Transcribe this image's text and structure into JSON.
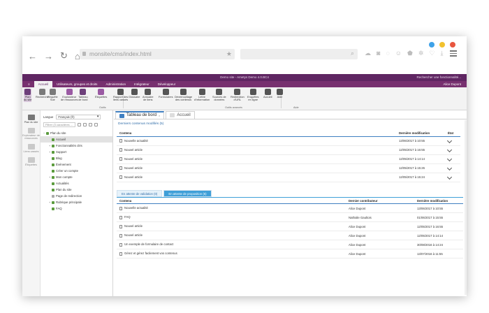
{
  "browser": {
    "url": "monsite/cms/index.html",
    "dot_colors": [
      "#3fa2e8",
      "#f2c12e",
      "#e8563f"
    ]
  },
  "app": {
    "titlebar": "Demo site - Ametys Demo 4.0.BC4",
    "search_hint": "Rechercher une fonctionnalité...",
    "user": "Alice Dupont",
    "ribbon_tabs": [
      "Accueil",
      "Utilisateurs, groupes et droits",
      "Administration",
      "Intégrateur",
      "Développeur"
    ],
    "ribbon_buttons": [
      {
        "label": "Plan\ndu site",
        "color": "#6d3f7a"
      },
      {
        "label": "Recherche",
        "color": "#7a7a7a"
      },
      {
        "label": "Requête\nSolr",
        "color": "#7a7a7a"
      },
      {
        "label": "Explorateur\nde ressources",
        "color": "#9a5aa3"
      },
      {
        "label": "Tableau\nde bord",
        "color": "#6d3f7a"
      },
      {
        "label": "Étiquettes",
        "color": "#9a5aa3"
      },
      {
        "label": "Rapport des\nliens cassés",
        "color": "#555555"
      },
      {
        "label": "Glossaire",
        "color": "#555555"
      },
      {
        "label": "Annuaire\nde liens",
        "color": "#555555"
      },
      {
        "label": "Formulaires",
        "color": "#555555"
      },
      {
        "label": "Déverrouillage\ndes contenus",
        "color": "#555555"
      },
      {
        "label": "Lettre\nd'information",
        "color": "#555555"
      },
      {
        "label": "Sources de\ndonnées",
        "color": "#555555"
      },
      {
        "label": "Redirection\nd'URL",
        "color": "#555555"
      },
      {
        "label": "Enquêtes\nen ligne",
        "color": "#555555"
      },
      {
        "label": "Accueil",
        "color": "#555555"
      },
      {
        "label": "Aide",
        "color": "#555555"
      }
    ],
    "groups": [
      "Outils",
      "Outils avancés",
      "Aide"
    ]
  },
  "rail": {
    "items": [
      "Plan\ndu site",
      "Explorateur\nde ressources",
      "Liens\ncassés",
      "Étiquettes"
    ]
  },
  "tree": {
    "language_label": "Langue",
    "language_value": "Français (fr)",
    "filter_placeholder": "Filtrer (3 caractères ...",
    "nodes": [
      {
        "label": "Plan du site",
        "level": 0,
        "color": "#5b9b3d"
      },
      {
        "label": "Accueil",
        "level": 1,
        "color": "#5b9b3d",
        "selected": true
      },
      {
        "label": "Fonctionnalités clés",
        "level": 1,
        "color": "#5b9b3d",
        "expand": true
      },
      {
        "label": "Support",
        "level": 1,
        "color": "#5b9b3d",
        "expand": true
      },
      {
        "label": "Blog",
        "level": 1,
        "color": "#5b9b3d"
      },
      {
        "label": "Événement",
        "level": 1,
        "color": "#5b9b3d"
      },
      {
        "label": "Créer un compte",
        "level": 1,
        "color": "#5b9b3d"
      },
      {
        "label": "Mon compte",
        "level": 1,
        "color": "#5b9b3d",
        "expand": true
      },
      {
        "label": "Actualités",
        "level": 1,
        "color": "#5b9b3d"
      },
      {
        "label": "Plan du site",
        "level": 1,
        "color": "#5b9b3d"
      },
      {
        "label": "Page de redirection",
        "level": 1,
        "color": "#aaaaaa"
      },
      {
        "label": "Rubrique principale",
        "level": 1,
        "color": "#5b9b3d",
        "expand": true
      },
      {
        "label": "FAQ",
        "level": 1,
        "color": "#5b9b3d"
      }
    ]
  },
  "main": {
    "tabs": [
      "Tableau de bord",
      "Accueil"
    ],
    "panel_title": "Derniers contenus modifiés (5)",
    "table1": {
      "headers": [
        "Contenu",
        "Dernière modification",
        "État"
      ],
      "rows": [
        {
          "title": "Nouvelle actualité",
          "date": "13/06/2017 à 10:55"
        },
        {
          "title": "Nouvel article",
          "date": "12/05/2017 à 16:55"
        },
        {
          "title": "Nouvel article",
          "date": "12/05/2017 à 14:14"
        },
        {
          "title": "Nouvel article",
          "date": "12/05/2017 à 15:26"
        },
        {
          "title": "Nouvel article",
          "date": "12/05/2017 à 15:24"
        }
      ]
    },
    "subtabs": [
      "En attente de validation (0)",
      "En attente de proposition (6)"
    ],
    "table2": {
      "headers": [
        "Contenu",
        "Dernier contributeur",
        "Dernière modification"
      ],
      "rows": [
        {
          "title": "Nouvelle actualité",
          "contributor": "Alice Dupont",
          "date": "13/06/2017 à 10:55"
        },
        {
          "title": "FAQ",
          "contributor": "Nathalie Gaultois",
          "date": "01/06/2017 à 15:55"
        },
        {
          "title": "Nouvel article",
          "contributor": "Alice Dupont",
          "date": "12/05/2017 à 16:55"
        },
        {
          "title": "Nouvel article",
          "contributor": "Alice Dupont",
          "date": "12/05/2017 à 14:14"
        },
        {
          "title": "Un exemple de formulaire de contact",
          "contributor": "Alice Dupont",
          "date": "30/08/2016 à 14:24"
        },
        {
          "title": "Gérez et gérez facilement vos contenus",
          "contributor": "Alice Dupont",
          "date": "13/07/2016 à 11:55"
        }
      ]
    }
  }
}
